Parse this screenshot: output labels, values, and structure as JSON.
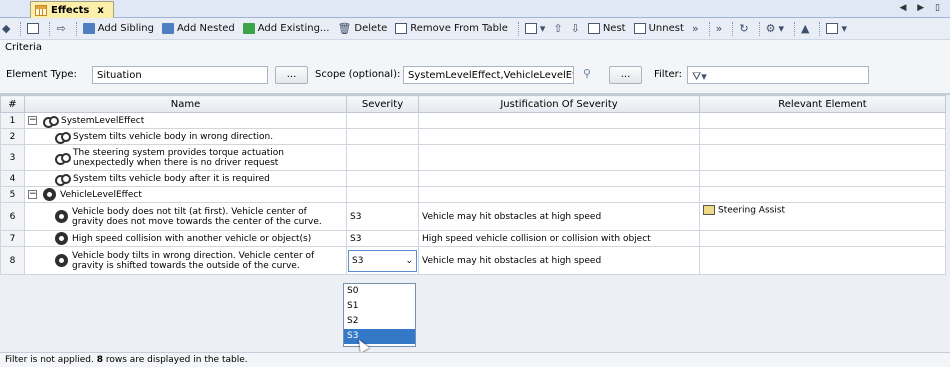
{
  "tab": {
    "title": "Effects",
    "close": "x",
    "nav": "◀ ▶ ▯"
  },
  "toolbar": {
    "add_sibling": "Add Sibling",
    "add_nested": "Add Nested",
    "add_existing": "Add Existing...",
    "delete": "Delete",
    "remove_from_table": "Remove From Table",
    "nest": "Nest",
    "unnest": "Unnest"
  },
  "criteria": {
    "title": "Criteria",
    "element_type_label": "Element Type:",
    "element_type_value": "Situation",
    "scope_label": "Scope (optional):",
    "scope_value": "SystemLevelEffect,VehicleLevelEffect",
    "browse_label": "...",
    "filter_label": "Filter:"
  },
  "table": {
    "columns": [
      "#",
      "Name",
      "Severity",
      "Justification Of Severity",
      "Relevant Element"
    ],
    "rows": [
      {
        "num": "1",
        "name": "SystemLevelEffect",
        "severity": "",
        "justification": "",
        "relevant": ""
      },
      {
        "num": "2",
        "name": "System tilts vehicle body in wrong direction.",
        "severity": "",
        "justification": "",
        "relevant": ""
      },
      {
        "num": "3",
        "name_line1": "The steering system provides torque actuation",
        "name_line2": "unexpectedly when there is no driver request",
        "severity": "",
        "justification": "",
        "relevant": ""
      },
      {
        "num": "4",
        "name": "System tilts vehicle body after it is required",
        "severity": "",
        "justification": "",
        "relevant": ""
      },
      {
        "num": "5",
        "name": "VehicleLevelEffect",
        "severity": "",
        "justification": "",
        "relevant": ""
      },
      {
        "num": "6",
        "name_line1": "Vehicle body does not tilt (at first).  Vehicle center of",
        "name_line2": "gravity does not move towards the center of the curve.",
        "severity": "S3",
        "justification": "Vehicle may hit obstacles at high speed",
        "relevant": "Steering Assist"
      },
      {
        "num": "7",
        "name": "High speed collision with another vehicle or object(s)",
        "severity": "S3",
        "justification": "High speed vehicle collision or collision with object",
        "relevant": ""
      },
      {
        "num": "8",
        "name_line1": "Vehicle body tilts in wrong direction. Vehicle center of",
        "name_line2": "gravity is shifted towards the outside of the curve.",
        "severity": "S3",
        "justification": "Vehicle may hit obstacles at high speed",
        "relevant": ""
      }
    ]
  },
  "dropdown": {
    "options": [
      "S0",
      "S1",
      "S2",
      "S3"
    ],
    "selected": "S3"
  },
  "status": {
    "prefix": "Filter is not applied. ",
    "count": "8",
    "suffix": " rows are displayed in the table."
  },
  "colors": {
    "selection": "#3478c8",
    "tab_bg": "#fcefa9",
    "toolbar_bg": "#e9eef6"
  }
}
